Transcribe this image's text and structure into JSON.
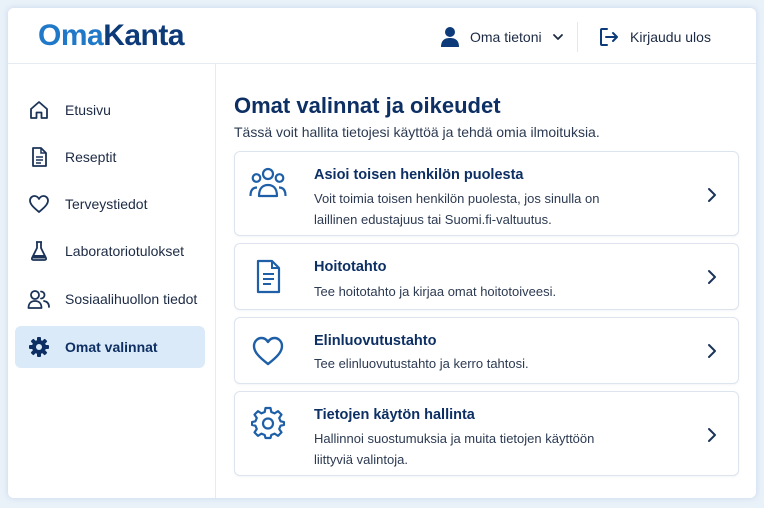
{
  "app": {
    "logo_part1": "Oma",
    "logo_part2": "Kanta"
  },
  "header": {
    "user_menu_label": "Oma tietoni",
    "logout_label": "Kirjaudu ulos"
  },
  "sidebar": {
    "items": [
      {
        "label": "Etusivu",
        "icon": "home-icon",
        "active": false
      },
      {
        "label": "Reseptit",
        "icon": "document-icon",
        "active": false
      },
      {
        "label": "Terveystiedot",
        "icon": "heart-icon",
        "active": false
      },
      {
        "label": "Laboratoriotulokset",
        "icon": "flask-icon",
        "active": false
      },
      {
        "label": "Sosiaalihuollon tiedot",
        "icon": "people-icon",
        "active": false
      },
      {
        "label": "Omat valinnat",
        "icon": "gear-icon",
        "active": true
      }
    ]
  },
  "main": {
    "title": "Omat valinnat ja oikeudet",
    "subtitle": "Tässä voit hallita tietojesi käyttöä ja tehdä omia ilmoituksia.",
    "cards": [
      {
        "title": "Asioi toisen henkilön puolesta",
        "desc": "Voit toimia toisen henkilön puolesta, jos sinulla on laillinen edustajuus tai Suomi.fi-valtuutus.",
        "icon": "group-icon"
      },
      {
        "title": "Hoitotahto",
        "desc": "Tee hoitotahto ja kirjaa omat hoitotoiveesi.",
        "icon": "document-icon"
      },
      {
        "title": "Elinluovutustahto",
        "desc": "Tee elinluovutustahto ja kerro tahtosi.",
        "icon": "heart-icon"
      },
      {
        "title": "Tietojen käytön hallinta",
        "desc": "Hallinnoi suostumuksia ja muita tietojen käyttöön liittyviä valintoja.",
        "icon": "gear-icon"
      }
    ]
  },
  "colors": {
    "brand_light": "#1f78c8",
    "brand_dark": "#0d3a78",
    "active_bg": "#dbeaf8",
    "background": "#e9f1f9"
  }
}
